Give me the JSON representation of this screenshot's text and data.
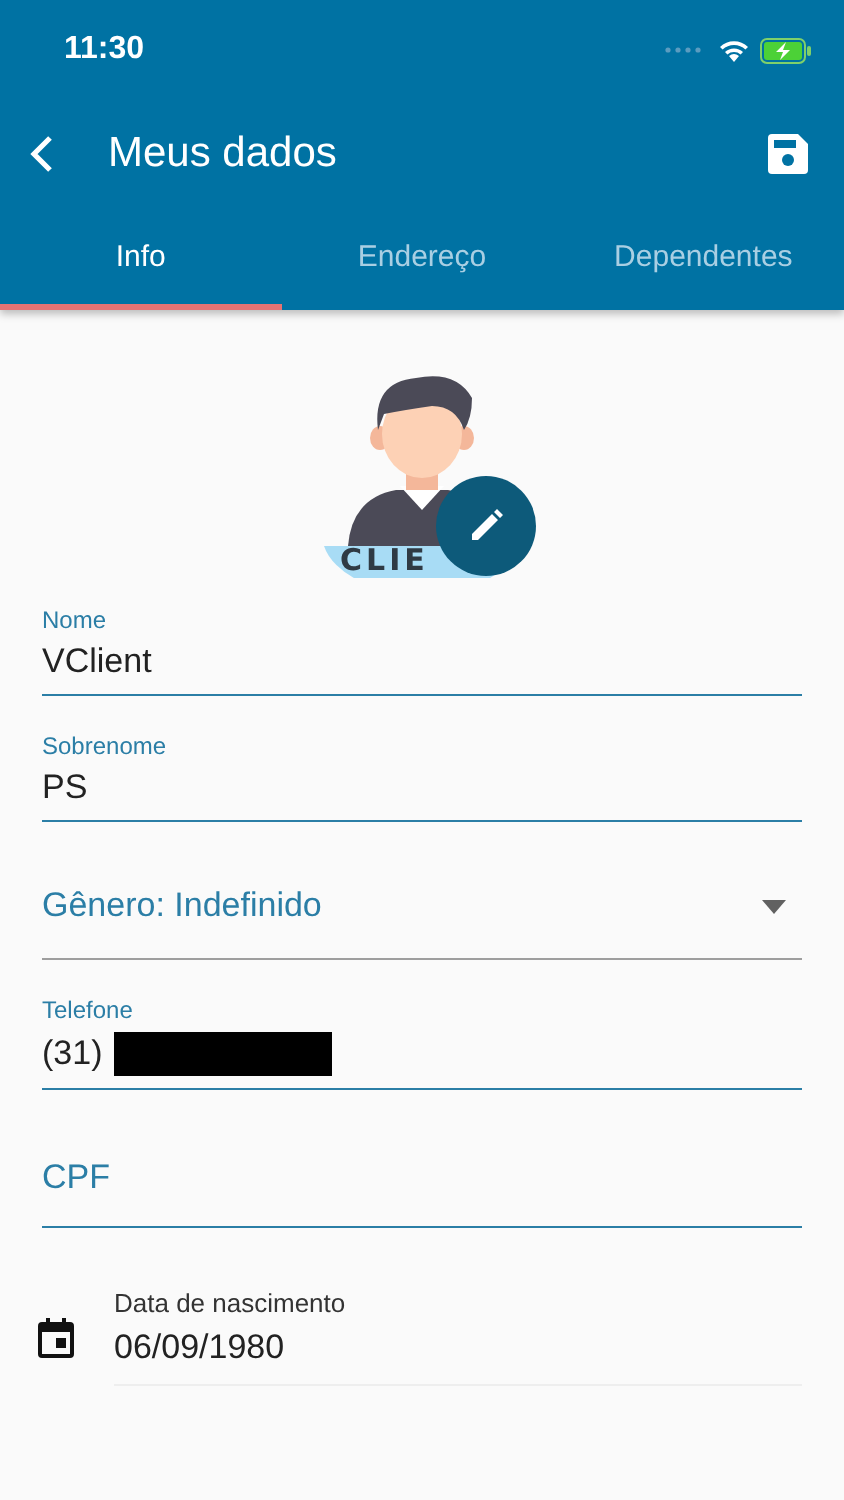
{
  "status_bar": {
    "time": "11:30"
  },
  "app_bar": {
    "title": "Meus dados"
  },
  "tabs": [
    {
      "label": "Info",
      "selected": true
    },
    {
      "label": "Endereço",
      "selected": false
    },
    {
      "label": "Dependentes",
      "selected": false
    }
  ],
  "avatar": {
    "badge_text": "CLIE"
  },
  "fields": [
    {
      "kind": "text",
      "label": "Nome",
      "value": "VClient"
    },
    {
      "kind": "text",
      "label": "Sobrenome",
      "value": "PS"
    },
    {
      "kind": "dropdown",
      "value": "Gênero: Indefinido"
    },
    {
      "kind": "text",
      "label": "Telefone",
      "value": "(31)",
      "redacted": true
    },
    {
      "kind": "text",
      "placeholder": "CPF"
    },
    {
      "kind": "date",
      "label": "Data de nascimento",
      "value": "06/09/1980"
    }
  ]
}
